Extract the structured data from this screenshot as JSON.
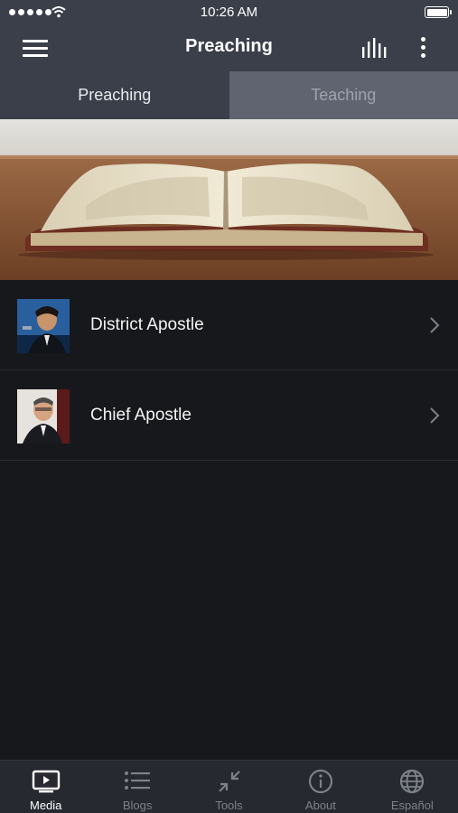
{
  "status_bar": {
    "time": "10:26 AM"
  },
  "nav": {
    "title": "Preaching"
  },
  "tabs": [
    {
      "label": "Preaching",
      "active": true
    },
    {
      "label": "Teaching",
      "active": false
    }
  ],
  "list": [
    {
      "label": "District Apostle"
    },
    {
      "label": "Chief Apostle"
    }
  ],
  "tab_bar": [
    {
      "label": "Media",
      "icon": "media-icon",
      "active": true
    },
    {
      "label": "Blogs",
      "icon": "list-icon",
      "active": false
    },
    {
      "label": "Tools",
      "icon": "tools-icon",
      "active": false
    },
    {
      "label": "About",
      "icon": "info-icon",
      "active": false
    },
    {
      "label": "Español",
      "icon": "globe-icon",
      "active": false
    }
  ],
  "colors": {
    "bar": "#3a3f49",
    "background": "#17181c",
    "tab_inactive": "#5f6470",
    "tab_bar": "#262930"
  }
}
